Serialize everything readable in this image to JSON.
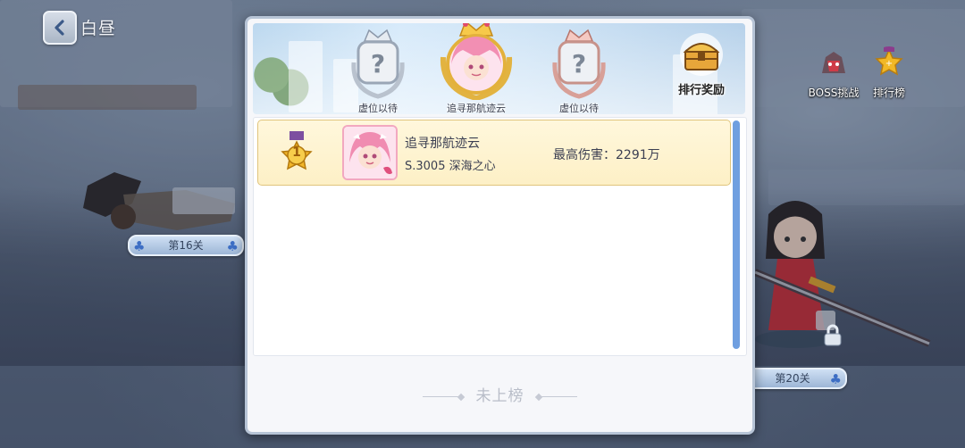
{
  "top": {
    "back_label": "白昼"
  },
  "side_buttons": [
    {
      "label": "BOSS挑战",
      "icon": "boss-icon"
    },
    {
      "label": "排行榜",
      "icon": "leaderboard-icon"
    }
  ],
  "stages": {
    "left": "第16关",
    "right": "第20关"
  },
  "panel": {
    "podium": {
      "second": {
        "label": "虚位以待",
        "icon": "silver-crown-question-icon"
      },
      "first": {
        "label": "追寻那航迹云",
        "icon": "gold-crown-avatar-icon"
      },
      "third": {
        "label": "虚位以待",
        "icon": "bronze-crown-question-icon"
      }
    },
    "reward_button": {
      "label": "排行奖励",
      "icon": "treasure-chest-icon"
    },
    "rows": [
      {
        "rank": "1",
        "name": "追寻那航迹云",
        "server": "S.3005 深海之心",
        "damage": "最高伤害：2291万"
      }
    ],
    "my_rank": "未上榜"
  },
  "colors": {
    "row_bg": "#fdf0c6",
    "scrollbar": "#6f9fe0",
    "panel_border": "#b7c4d6"
  }
}
